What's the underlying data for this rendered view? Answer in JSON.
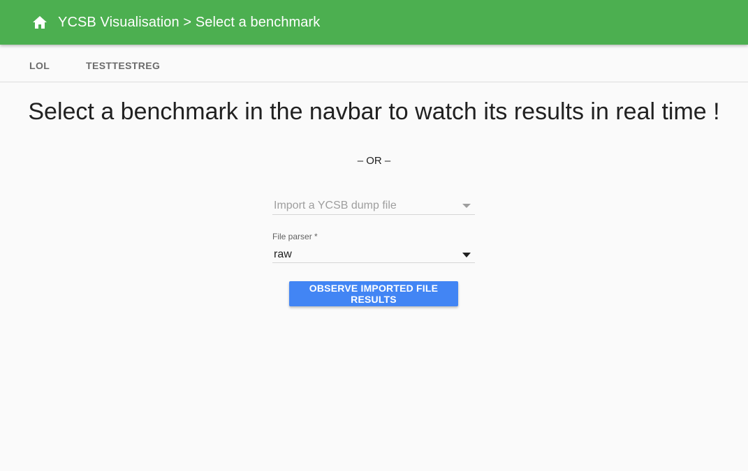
{
  "appbar": {
    "title": "YCSB Visualisation > Select a benchmark",
    "home_icon": "home-icon",
    "color": "#4caf50"
  },
  "tabs": [
    {
      "label": "LOL"
    },
    {
      "label": "TESTTESTREG"
    }
  ],
  "main": {
    "headline": "Select a benchmark in the navbar to watch its results in real time !",
    "separator": "– OR –",
    "file_select": {
      "placeholder": "Import a YCSB dump file",
      "icon": "dropdown-arrow-icon"
    },
    "parser_select": {
      "label": "File parser *",
      "value": "raw",
      "icon": "dropdown-arrow-icon"
    },
    "observe_button": {
      "label": "OBSERVE IMPORTED FILE RESULTS",
      "color": "#4285f4"
    }
  }
}
